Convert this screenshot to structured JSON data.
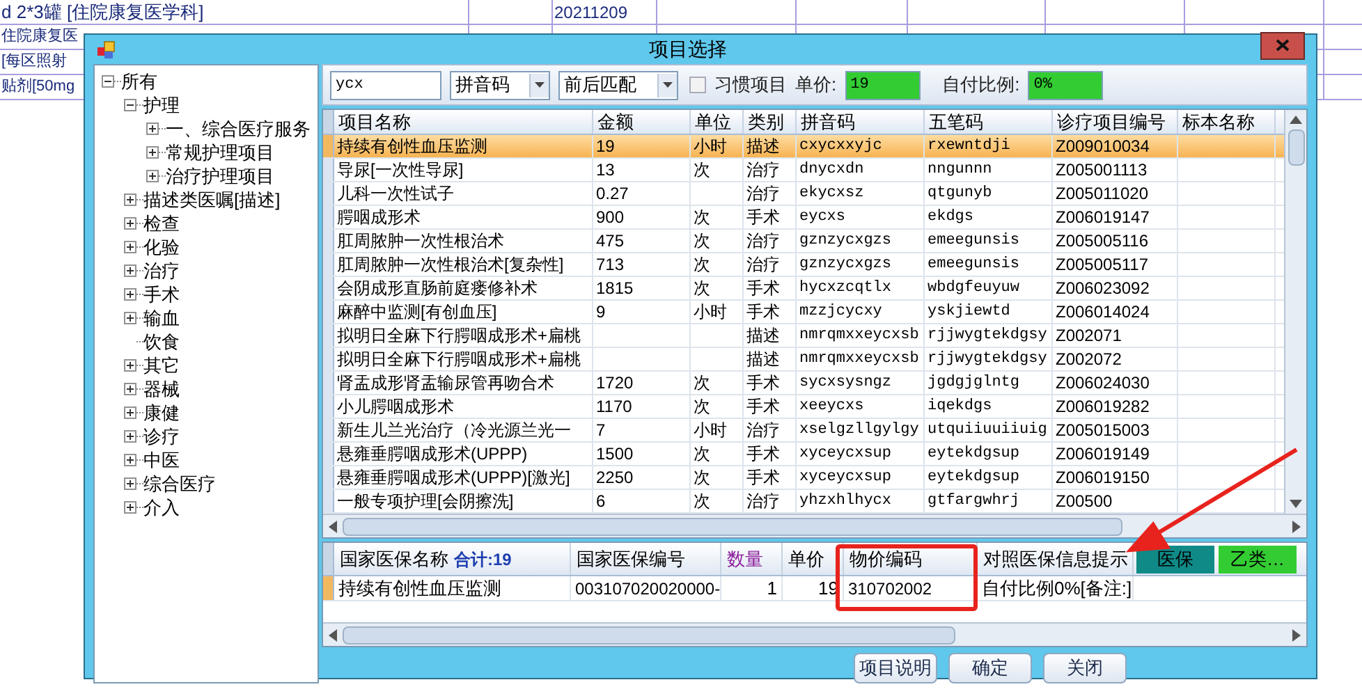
{
  "background_sheet": {
    "rows": [
      {
        "cells": [
          "d 2*3罐 [住院康复医学科]",
          "20211209"
        ]
      },
      {
        "cells": [
          "住院康复医"
        ]
      },
      {
        "cells": [
          "[每区照射"
        ]
      },
      {
        "cells": [
          "贴剂[50mg"
        ]
      }
    ]
  },
  "dialog": {
    "title": "项目选择"
  },
  "tree": [
    {
      "label": "所有",
      "expanded": true,
      "children": [
        {
          "label": "护理",
          "expanded": true,
          "children": [
            {
              "label": "一、综合医疗服务",
              "expanded": false
            },
            {
              "label": "常规护理项目",
              "expanded": false
            },
            {
              "label": "治疗护理项目",
              "expanded": false
            }
          ]
        },
        {
          "label": "描述类医嘱[描述]",
          "expanded": false
        },
        {
          "label": "检查",
          "expanded": false
        },
        {
          "label": "化验",
          "expanded": false
        },
        {
          "label": "治疗",
          "expanded": false
        },
        {
          "label": "手术",
          "expanded": false
        },
        {
          "label": "输血",
          "expanded": false
        },
        {
          "label": "饮食"
        },
        {
          "label": "其它",
          "expanded": false
        },
        {
          "label": "器械",
          "expanded": false
        },
        {
          "label": "康健",
          "expanded": false
        },
        {
          "label": "诊疗",
          "expanded": false
        },
        {
          "label": "中医",
          "expanded": false
        },
        {
          "label": "综合医疗",
          "expanded": false
        },
        {
          "label": "介入",
          "expanded": false
        }
      ]
    }
  ],
  "toolbar": {
    "search_value": "ycx",
    "code_type": "拼音码",
    "match_mode": "前后匹配",
    "habit_label": "习惯项目",
    "habit_checked": false,
    "price_label": "单价:",
    "price_value": "19",
    "ratio_label": "自付比例:",
    "ratio_value": "0%"
  },
  "items_table": {
    "columns": [
      "项目名称",
      "金额",
      "单位",
      "类别",
      "拼音码",
      "五笔码",
      "诊疗项目编号",
      "标本名称"
    ],
    "rows": [
      {
        "selected": true,
        "cells": [
          "持续有创性血压监测",
          "19",
          "小时",
          "描述",
          "cxycxxyjc",
          "rxewntdji",
          "Z009010034",
          ""
        ]
      },
      {
        "selected": false,
        "cells": [
          "导尿[一次性导尿]",
          "13",
          "次",
          "治疗",
          "dnycxdn",
          "nngunnn",
          "Z005001113",
          ""
        ]
      },
      {
        "selected": false,
        "cells": [
          "儿科一次性试子",
          "0.27",
          "",
          "治疗",
          "ekycxsz",
          "qtgunyb",
          "Z005011020",
          ""
        ]
      },
      {
        "selected": false,
        "cells": [
          "腭咽成形术",
          "900",
          "次",
          "手术",
          "eycxs",
          "ekdgs",
          "Z006019147",
          ""
        ]
      },
      {
        "selected": false,
        "cells": [
          "肛周脓肿一次性根治术",
          "475",
          "次",
          "治疗",
          "gznzycxgzs",
          "emeegunsis",
          "Z005005116",
          ""
        ]
      },
      {
        "selected": false,
        "cells": [
          "肛周脓肿一次性根治术[复杂性]",
          "713",
          "次",
          "治疗",
          "gznzycxgzs",
          "emeegunsis",
          "Z005005117",
          ""
        ]
      },
      {
        "selected": false,
        "cells": [
          "会阴成形直肠前庭瘘修补术",
          "1815",
          "次",
          "手术",
          "hycxzcqtlx",
          "wbdgfeuyuw",
          "Z006023092",
          ""
        ]
      },
      {
        "selected": false,
        "cells": [
          "麻醉中监测[有创血压]",
          "9",
          "小时",
          "手术",
          "mzzjcycxy",
          "yskjiewtd",
          "Z006014024",
          ""
        ]
      },
      {
        "selected": false,
        "cells": [
          "拟明日全麻下行腭咽成形术+扁桃",
          "",
          "",
          "描述",
          "nmrqmxxeycxsb",
          "rjjwygtekdgsy",
          "Z002071",
          ""
        ]
      },
      {
        "selected": false,
        "cells": [
          "拟明日全麻下行腭咽成形术+扁桃",
          "",
          "",
          "描述",
          "nmrqmxxeycxsb",
          "rjjwygtekdgsy",
          "Z002072",
          ""
        ]
      },
      {
        "selected": false,
        "cells": [
          "肾盂成形肾盂输尿管再吻合术",
          "1720",
          "次",
          "手术",
          "sycxsysngz",
          "jgdgjglntg",
          "Z006024030",
          ""
        ]
      },
      {
        "selected": false,
        "cells": [
          "小儿腭咽成形术",
          "1170",
          "次",
          "手术",
          "xeeycxs",
          "iqekdgs",
          "Z006019282",
          ""
        ]
      },
      {
        "selected": false,
        "cells": [
          "新生儿兰光治疗（冷光源兰光一",
          "7",
          "小时",
          "治疗",
          "xselgzllgylgy",
          "utquiiuuiiuig",
          "Z005015003",
          ""
        ]
      },
      {
        "selected": false,
        "cells": [
          "悬雍垂腭咽成形术(UPPP)",
          "1500",
          "次",
          "手术",
          "xyceycxsup",
          "eytekdgsup",
          "Z006019149",
          ""
        ]
      },
      {
        "selected": false,
        "cells": [
          "悬雍垂腭咽成形术(UPPP)[激光]",
          "2250",
          "次",
          "手术",
          "xyceycxsup",
          "eytekdgsup",
          "Z006019150",
          ""
        ]
      },
      {
        "selected": false,
        "cells": [
          "一般专项护理[会阴擦洗]",
          "6",
          "次",
          "治疗",
          "yhzxhlhycx",
          "gtfargwhrj",
          "Z00500",
          ""
        ]
      }
    ]
  },
  "detail_table": {
    "columns": [
      {
        "label": "国家医保名称",
        "kind": "name"
      },
      {
        "label": "国家医保编号",
        "kind": "plain"
      },
      {
        "label": "数量",
        "kind": "highlight"
      },
      {
        "label": "单价",
        "kind": "plain"
      },
      {
        "label": "物价编码",
        "kind": "plain"
      },
      {
        "label": "对照医保信息提示",
        "kind": "plain"
      }
    ],
    "total": "合计:19",
    "tags": [
      {
        "label": "医保",
        "color": "#0f8a87"
      },
      {
        "label": "乙类…",
        "color": "#33cc33"
      }
    ],
    "rows": [
      {
        "cells": [
          "持续有创性血压监测",
          "003107020020000-",
          "1",
          "19",
          "310702002",
          "自付比例0%[备注:]"
        ]
      }
    ]
  },
  "buttons": [
    "项目说明",
    "确定",
    "关闭"
  ]
}
